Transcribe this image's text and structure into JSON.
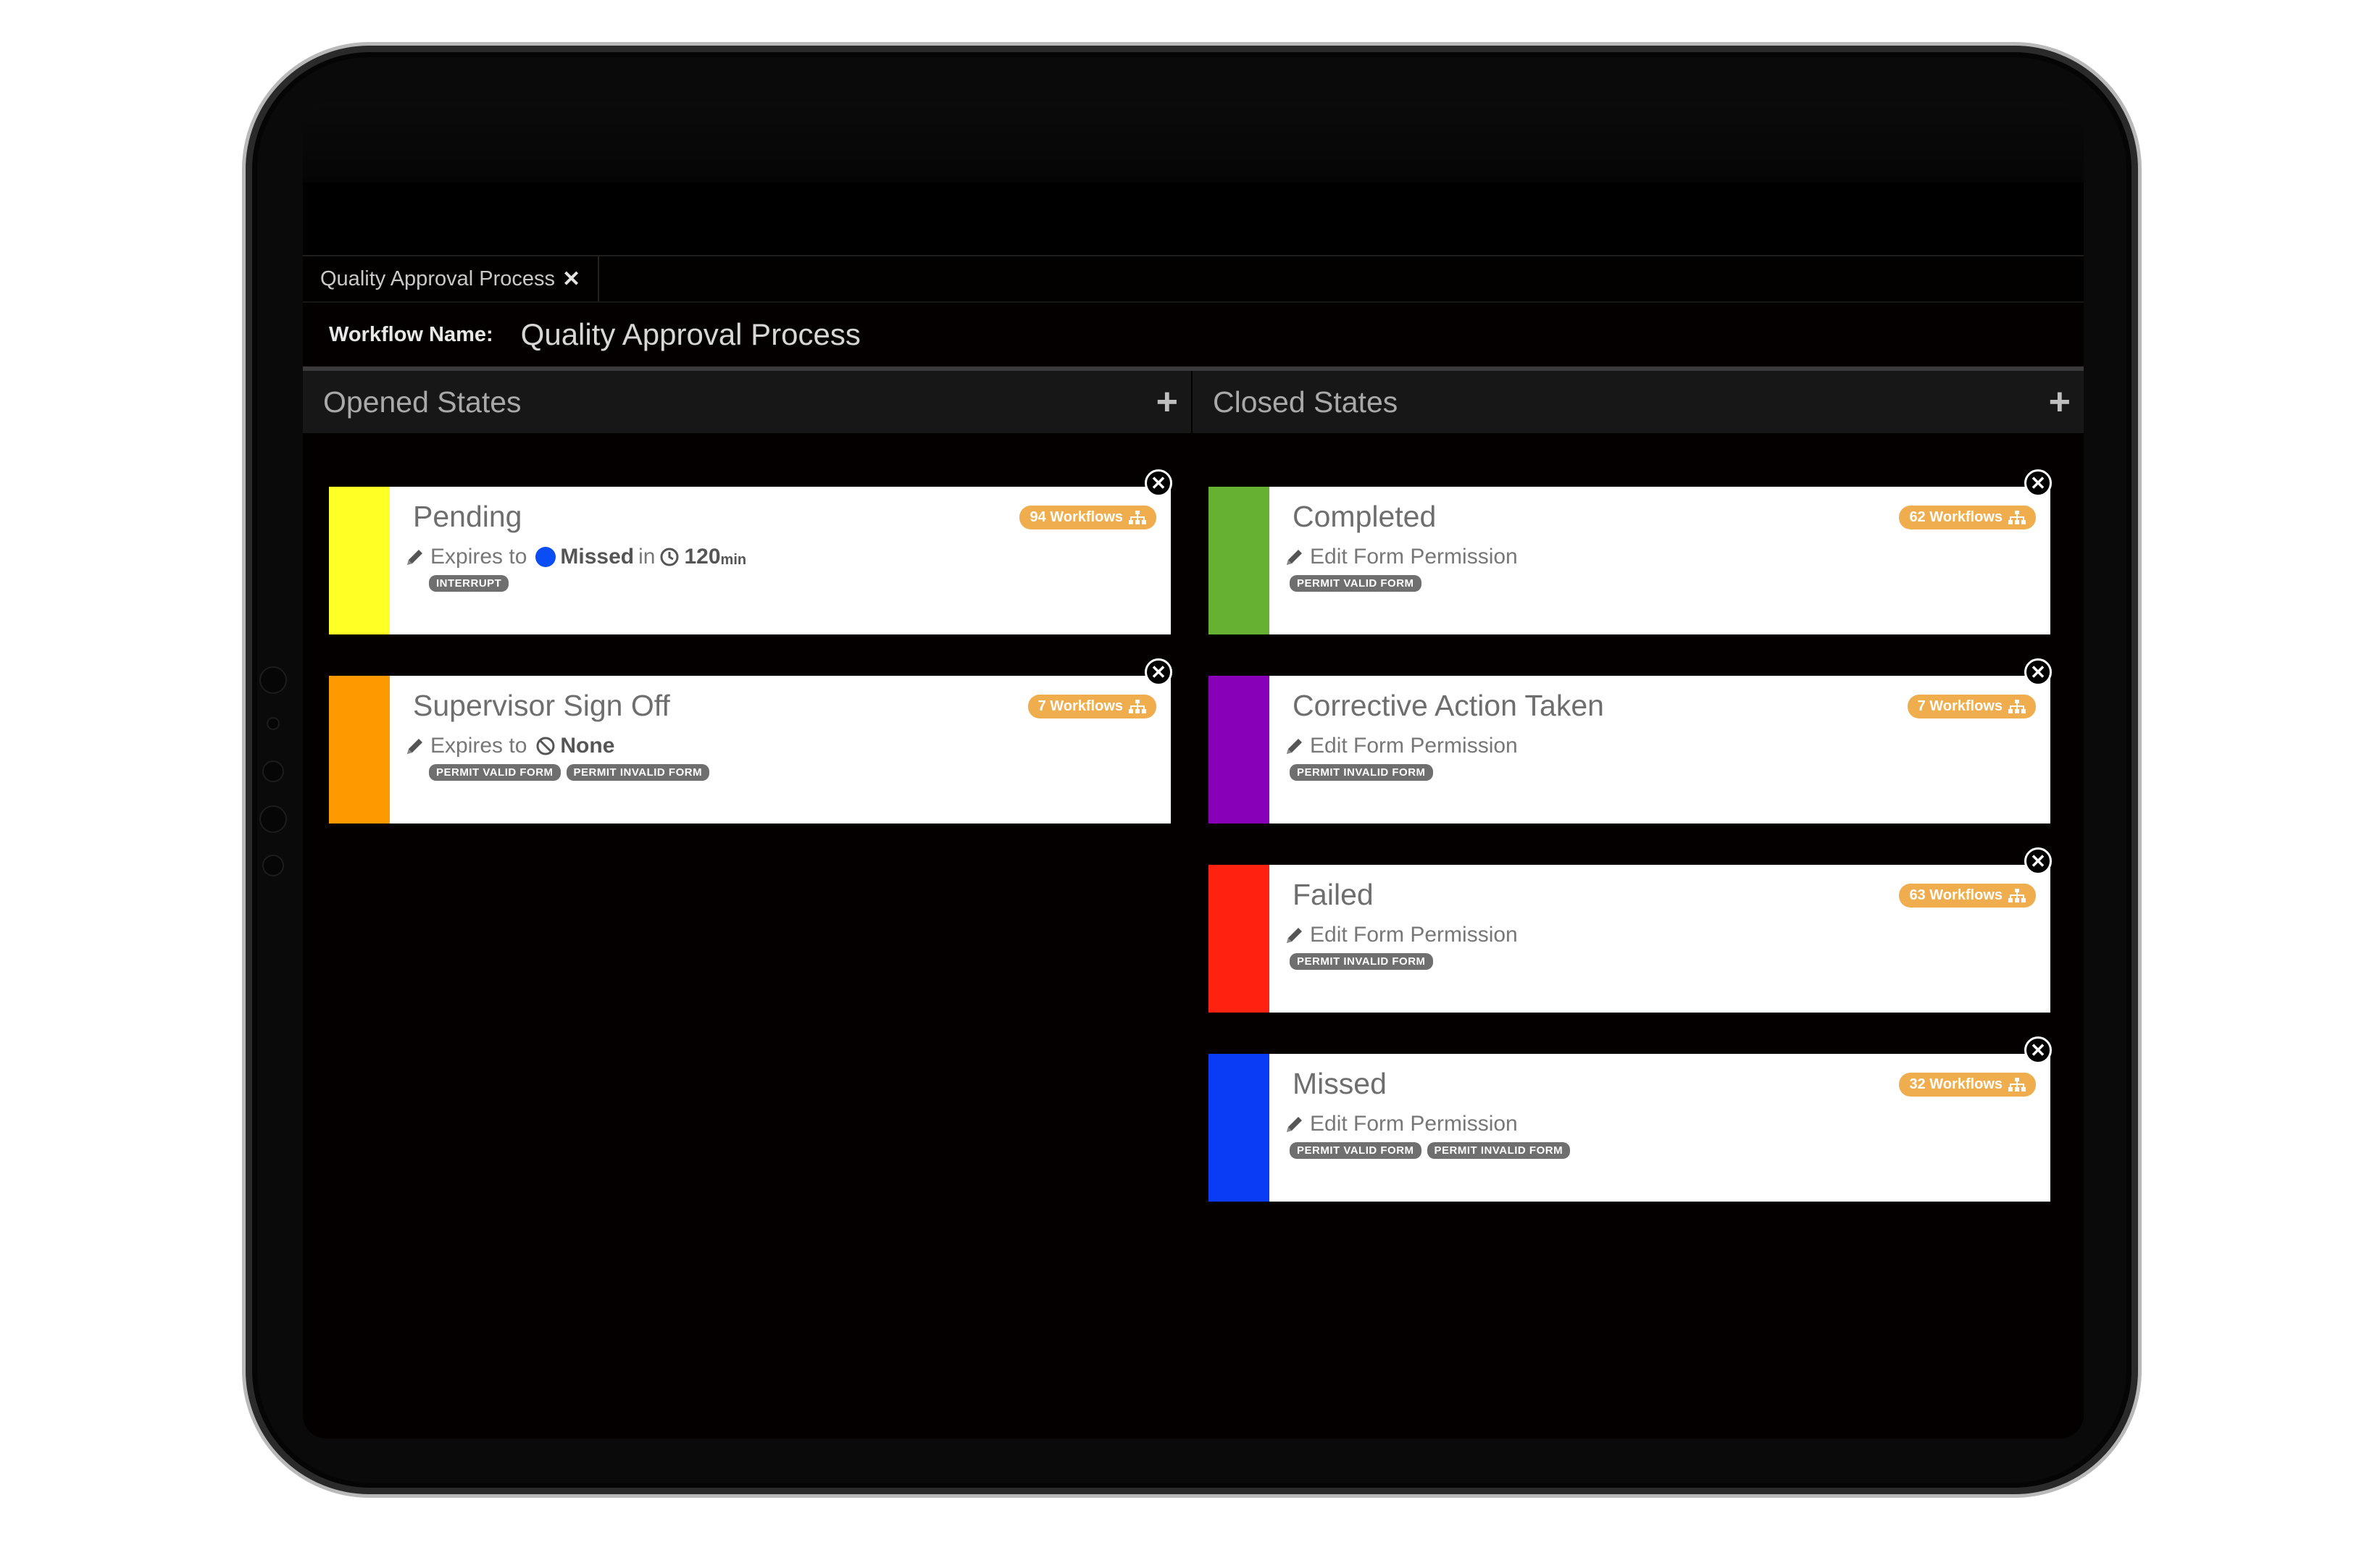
{
  "tab": {
    "label": "Quality Approval Process",
    "close_icon": "✕"
  },
  "workflow": {
    "label": "Workflow Name:",
    "name": "Quality Approval Process"
  },
  "columns": {
    "opened_title": "Opened States",
    "closed_title": "Closed States",
    "add_icon": "+"
  },
  "colors": {
    "badge": "#f0ad4e",
    "missed_dot": "#0b4df5"
  },
  "opened": [
    {
      "name": "Pending",
      "color": "#ffff26",
      "badge": "94 Workflows",
      "expires_label": "Expires to",
      "target": "Missed",
      "in_label": "in",
      "minutes": "120",
      "min_unit": "min",
      "tags": [
        "INTERRUPT"
      ]
    },
    {
      "name": "Supervisor Sign Off",
      "color": "#ff9900",
      "badge": "7 Workflows",
      "expires_label": "Expires to",
      "target": "None",
      "tags": [
        "PERMIT VALID FORM",
        "PERMIT INVALID FORM"
      ]
    }
  ],
  "closed": [
    {
      "name": "Completed",
      "color": "#66b032",
      "badge": "62 Workflows",
      "perm": "Edit Form Permission",
      "tags": [
        "PERMIT VALID FORM"
      ]
    },
    {
      "name": "Corrective Action Taken",
      "color": "#8800b8",
      "badge": "7 Workflows",
      "perm": "Edit Form Permission",
      "tags": [
        "PERMIT INVALID FORM"
      ]
    },
    {
      "name": "Failed",
      "color": "#ff2211",
      "badge": "63 Workflows",
      "perm": "Edit Form Permission",
      "tags": [
        "PERMIT INVALID FORM"
      ]
    },
    {
      "name": "Missed",
      "color": "#0a3cf5",
      "badge": "32 Workflows",
      "perm": "Edit Form Permission",
      "tags": [
        "PERMIT VALID FORM",
        "PERMIT INVALID FORM"
      ]
    }
  ]
}
